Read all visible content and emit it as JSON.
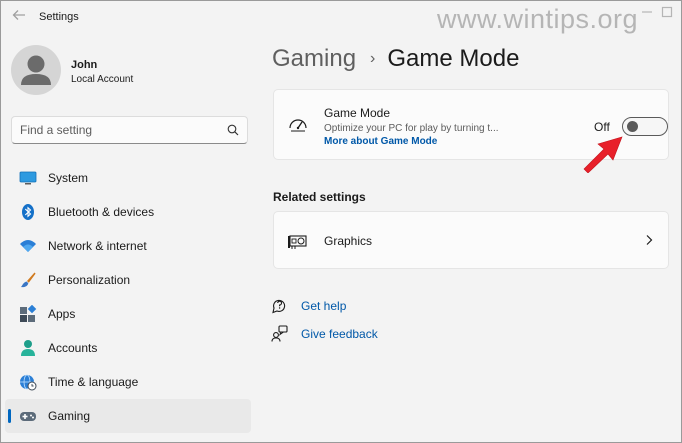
{
  "window": {
    "title": "Settings",
    "watermark": "www.wintips.org"
  },
  "user": {
    "name": "John",
    "account_type": "Local Account"
  },
  "search": {
    "placeholder": "Find a setting"
  },
  "sidebar": {
    "items": [
      {
        "label": "System",
        "icon": "monitor-icon"
      },
      {
        "label": "Bluetooth & devices",
        "icon": "bluetooth-icon"
      },
      {
        "label": "Network & internet",
        "icon": "wifi-icon"
      },
      {
        "label": "Personalization",
        "icon": "paintbrush-icon"
      },
      {
        "label": "Apps",
        "icon": "apps-icon"
      },
      {
        "label": "Accounts",
        "icon": "person-icon"
      },
      {
        "label": "Time & language",
        "icon": "globe-clock-icon"
      },
      {
        "label": "Gaming",
        "icon": "gamepad-icon",
        "active": true
      }
    ]
  },
  "breadcrumb": {
    "parent": "Gaming",
    "separator": "›",
    "current": "Game Mode"
  },
  "game_mode": {
    "title": "Game Mode",
    "description": "Optimize your PC for play by turning t...",
    "link": "More about Game Mode",
    "toggle_state_label": "Off",
    "enabled": false
  },
  "related": {
    "heading": "Related settings",
    "items": [
      {
        "label": "Graphics",
        "icon": "graphics-card-icon"
      }
    ]
  },
  "help": {
    "get_help": "Get help",
    "give_feedback": "Give feedback"
  },
  "colors": {
    "accent": "#0067c0",
    "link": "#0058a8",
    "annotation_arrow": "#e8202a"
  }
}
